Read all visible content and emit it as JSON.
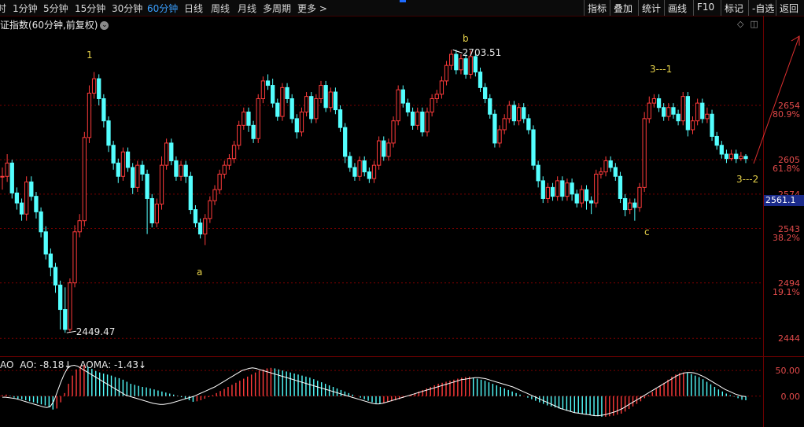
{
  "toolbar": {
    "periods": [
      {
        "label": "时",
        "active": false
      },
      {
        "label": "1分钟",
        "active": false
      },
      {
        "label": "5分钟",
        "active": false
      },
      {
        "label": "15分钟",
        "active": false
      },
      {
        "label": "30分钟",
        "active": false
      },
      {
        "label": "60分钟",
        "active": true
      },
      {
        "label": "日线",
        "active": false
      },
      {
        "label": "周线",
        "active": false
      },
      {
        "label": "月线",
        "active": false
      },
      {
        "label": "多周期",
        "active": false
      },
      {
        "label": "更多 >",
        "active": false
      }
    ],
    "tools": [
      "指标",
      "叠加",
      "统计",
      "画线",
      "F10",
      "标记",
      "-自选",
      "返回"
    ]
  },
  "chart_title": "证指数(60分钟,前复权)",
  "colors": {
    "up": "#ff3b3b",
    "down": "#54ffff",
    "axis": "#e24a4a",
    "grid": "#7a0000",
    "annotation": "#e8d34a",
    "ao_line": "#ffffff"
  },
  "price_axis": [
    {
      "value": "2654",
      "pct": "80.9%"
    },
    {
      "value": "2605",
      "pct": "61.8%"
    },
    {
      "value": "2574",
      "pct": ""
    },
    {
      "value": "2543",
      "pct": "38.2%"
    },
    {
      "value": "2494",
      "pct": "19.1%"
    },
    {
      "value": "2444",
      "pct": ""
    }
  ],
  "current_price": "2561.1",
  "ao_axis": [
    "50.00",
    "0.00"
  ],
  "ao_header": {
    "name": "AO",
    "ao": "AO: -8.18",
    "aoma": "AOMA: -1.43"
  },
  "annotations": {
    "high_marker": "2703.51",
    "low_marker": "2449.47",
    "wave_labels": [
      "1",
      "a",
      "b",
      "c",
      "3---1",
      "3---2"
    ]
  },
  "chart_data": {
    "type": "candlestick",
    "ylim": [
      2430,
      2722
    ],
    "high_value": 2703.51,
    "low_value": 2449.47,
    "candles": [
      [
        2590,
        2590,
        2598,
        2578
      ],
      [
        2590,
        2602,
        2610,
        2585
      ],
      [
        2602,
        2575,
        2605,
        2570
      ],
      [
        2575,
        2566,
        2580,
        2560
      ],
      [
        2566,
        2556,
        2570,
        2550
      ],
      [
        2556,
        2585,
        2590,
        2550
      ],
      [
        2585,
        2572,
        2590,
        2568
      ],
      [
        2572,
        2558,
        2576,
        2552
      ],
      [
        2558,
        2540,
        2562,
        2535
      ],
      [
        2540,
        2520,
        2545,
        2515
      ],
      [
        2520,
        2508,
        2525,
        2500
      ],
      [
        2508,
        2492,
        2512,
        2485
      ],
      [
        2492,
        2470,
        2496,
        2452
      ],
      [
        2470,
        2452,
        2490,
        2449
      ],
      [
        2452,
        2494,
        2498,
        2450
      ],
      [
        2494,
        2540,
        2546,
        2490
      ],
      [
        2540,
        2550,
        2556,
        2535
      ],
      [
        2550,
        2625,
        2630,
        2545
      ],
      [
        2625,
        2665,
        2672,
        2620
      ],
      [
        2665,
        2678,
        2684,
        2660
      ],
      [
        2678,
        2660,
        2682,
        2654
      ],
      [
        2660,
        2640,
        2664,
        2634
      ],
      [
        2640,
        2618,
        2644,
        2612
      ],
      [
        2618,
        2602,
        2622,
        2596
      ],
      [
        2602,
        2590,
        2606,
        2584
      ],
      [
        2590,
        2612,
        2616,
        2586
      ],
      [
        2612,
        2598,
        2616,
        2594
      ],
      [
        2598,
        2580,
        2602,
        2574
      ],
      [
        2580,
        2600,
        2604,
        2576
      ],
      [
        2600,
        2592,
        2604,
        2586
      ],
      [
        2592,
        2570,
        2596,
        2538
      ],
      [
        2570,
        2548,
        2574,
        2544
      ],
      [
        2548,
        2565,
        2570,
        2544
      ],
      [
        2565,
        2600,
        2608,
        2560
      ],
      [
        2600,
        2620,
        2624,
        2596
      ],
      [
        2620,
        2604,
        2624,
        2600
      ],
      [
        2604,
        2590,
        2608,
        2586
      ],
      [
        2590,
        2600,
        2604,
        2586
      ],
      [
        2600,
        2590,
        2604,
        2584
      ],
      [
        2590,
        2560,
        2594,
        2556
      ],
      [
        2560,
        2548,
        2564,
        2544
      ],
      [
        2548,
        2538,
        2552,
        2534
      ],
      [
        2538,
        2552,
        2556,
        2528
      ],
      [
        2552,
        2568,
        2572,
        2548
      ],
      [
        2568,
        2578,
        2582,
        2564
      ],
      [
        2578,
        2592,
        2596,
        2574
      ],
      [
        2592,
        2600,
        2604,
        2588
      ],
      [
        2600,
        2606,
        2610,
        2596
      ],
      [
        2606,
        2618,
        2622,
        2602
      ],
      [
        2618,
        2636,
        2640,
        2614
      ],
      [
        2636,
        2648,
        2652,
        2632
      ],
      [
        2648,
        2636,
        2652,
        2630
      ],
      [
        2636,
        2624,
        2640,
        2620
      ],
      [
        2624,
        2660,
        2664,
        2620
      ],
      [
        2660,
        2676,
        2680,
        2656
      ],
      [
        2676,
        2672,
        2682,
        2668
      ],
      [
        2672,
        2656,
        2678,
        2652
      ],
      [
        2656,
        2644,
        2660,
        2640
      ],
      [
        2644,
        2670,
        2674,
        2640
      ],
      [
        2670,
        2660,
        2674,
        2656
      ],
      [
        2660,
        2642,
        2664,
        2638
      ],
      [
        2642,
        2630,
        2646,
        2624
      ],
      [
        2630,
        2648,
        2652,
        2626
      ],
      [
        2648,
        2662,
        2666,
        2644
      ],
      [
        2662,
        2642,
        2666,
        2638
      ],
      [
        2642,
        2660,
        2664,
        2638
      ],
      [
        2660,
        2672,
        2676,
        2656
      ],
      [
        2672,
        2652,
        2676,
        2648
      ],
      [
        2652,
        2666,
        2670,
        2648
      ],
      [
        2666,
        2650,
        2670,
        2646
      ],
      [
        2650,
        2634,
        2654,
        2630
      ],
      [
        2634,
        2608,
        2638,
        2602
      ],
      [
        2608,
        2598,
        2612,
        2594
      ],
      [
        2598,
        2590,
        2602,
        2586
      ],
      [
        2590,
        2604,
        2608,
        2586
      ],
      [
        2604,
        2594,
        2608,
        2590
      ],
      [
        2594,
        2588,
        2598,
        2584
      ],
      [
        2588,
        2600,
        2604,
        2584
      ],
      [
        2600,
        2622,
        2626,
        2596
      ],
      [
        2622,
        2608,
        2626,
        2604
      ],
      [
        2608,
        2620,
        2624,
        2604
      ],
      [
        2620,
        2640,
        2644,
        2616
      ],
      [
        2640,
        2668,
        2672,
        2636
      ],
      [
        2668,
        2656,
        2672,
        2652
      ],
      [
        2656,
        2648,
        2660,
        2644
      ],
      [
        2648,
        2636,
        2652,
        2632
      ],
      [
        2636,
        2648,
        2652,
        2632
      ],
      [
        2648,
        2630,
        2652,
        2626
      ],
      [
        2630,
        2648,
        2652,
        2626
      ],
      [
        2648,
        2660,
        2664,
        2644
      ],
      [
        2660,
        2664,
        2668,
        2656
      ],
      [
        2664,
        2676,
        2680,
        2660
      ],
      [
        2676,
        2690,
        2694,
        2672
      ],
      [
        2690,
        2700,
        2704,
        2686
      ],
      [
        2700,
        2686,
        2704,
        2682
      ],
      [
        2686,
        2696,
        2700,
        2682
      ],
      [
        2696,
        2682,
        2700,
        2678
      ],
      [
        2682,
        2698,
        2703.51,
        2678
      ],
      [
        2698,
        2684,
        2700,
        2680
      ],
      [
        2684,
        2670,
        2688,
        2666
      ],
      [
        2670,
        2660,
        2674,
        2656
      ],
      [
        2660,
        2646,
        2664,
        2642
      ],
      [
        2646,
        2620,
        2650,
        2616
      ],
      [
        2620,
        2632,
        2636,
        2616
      ],
      [
        2632,
        2642,
        2646,
        2628
      ],
      [
        2642,
        2654,
        2658,
        2638
      ],
      [
        2654,
        2640,
        2658,
        2636
      ],
      [
        2640,
        2652,
        2656,
        2636
      ],
      [
        2652,
        2642,
        2656,
        2638
      ],
      [
        2642,
        2632,
        2646,
        2628
      ],
      [
        2632,
        2600,
        2636,
        2596
      ],
      [
        2600,
        2586,
        2604,
        2580
      ],
      [
        2586,
        2570,
        2590,
        2566
      ],
      [
        2570,
        2580,
        2584,
        2566
      ],
      [
        2580,
        2572,
        2584,
        2568
      ],
      [
        2572,
        2586,
        2590,
        2568
      ],
      [
        2586,
        2572,
        2590,
        2568
      ],
      [
        2572,
        2584,
        2588,
        2568
      ],
      [
        2584,
        2574,
        2588,
        2568
      ],
      [
        2574,
        2566,
        2578,
        2562
      ],
      [
        2566,
        2578,
        2582,
        2562
      ],
      [
        2578,
        2568,
        2582,
        2560
      ],
      [
        2568,
        2566,
        2572,
        2556
      ],
      [
        2566,
        2592,
        2596,
        2562
      ],
      [
        2592,
        2594,
        2598,
        2588
      ],
      [
        2594,
        2604,
        2608,
        2590
      ],
      [
        2604,
        2598,
        2608,
        2594
      ],
      [
        2598,
        2590,
        2602,
        2586
      ],
      [
        2590,
        2570,
        2594,
        2566
      ],
      [
        2570,
        2560,
        2574,
        2554
      ],
      [
        2560,
        2566,
        2570,
        2556
      ],
      [
        2566,
        2562,
        2570,
        2550
      ],
      [
        2562,
        2580,
        2584,
        2558
      ],
      [
        2580,
        2642,
        2648,
        2576
      ],
      [
        2642,
        2656,
        2662,
        2638
      ],
      [
        2656,
        2660,
        2664,
        2652
      ],
      [
        2660,
        2652,
        2664,
        2648
      ],
      [
        2652,
        2644,
        2656,
        2640
      ],
      [
        2644,
        2652,
        2656,
        2640
      ],
      [
        2652,
        2646,
        2656,
        2642
      ],
      [
        2646,
        2640,
        2650,
        2636
      ],
      [
        2640,
        2662,
        2666,
        2636
      ],
      [
        2662,
        2632,
        2666,
        2626
      ],
      [
        2632,
        2640,
        2644,
        2628
      ],
      [
        2640,
        2656,
        2660,
        2636
      ],
      [
        2656,
        2642,
        2660,
        2638
      ],
      [
        2642,
        2646,
        2652,
        2638
      ],
      [
        2646,
        2626,
        2650,
        2622
      ],
      [
        2626,
        2618,
        2630,
        2614
      ],
      [
        2618,
        2610,
        2622,
        2606
      ],
      [
        2610,
        2606,
        2614,
        2602
      ],
      [
        2606,
        2610,
        2614,
        2604
      ],
      [
        2610,
        2606,
        2614,
        2602
      ],
      [
        2606,
        2608,
        2612,
        2604
      ],
      [
        2608,
        2606,
        2610,
        2602
      ]
    ],
    "ao_values": [
      2,
      3,
      1,
      -3,
      -5,
      -6,
      -8,
      -10,
      -12,
      -14,
      -16,
      -18,
      -22,
      -26,
      -24,
      -12,
      6,
      24,
      40,
      52,
      58,
      60,
      57,
      53,
      49,
      46,
      44,
      42,
      40,
      37,
      35,
      32,
      28,
      24,
      22,
      20,
      18,
      17,
      15,
      13,
      11,
      9,
      7,
      5,
      3,
      1,
      -2,
      -5,
      -8,
      -11,
      -10,
      -8,
      -5,
      -2,
      2,
      6,
      10,
      14,
      18,
      22,
      26,
      30,
      34,
      38,
      42,
      46,
      50,
      52,
      54,
      55,
      54,
      52,
      50,
      48,
      46,
      44,
      42,
      40,
      38,
      36,
      33,
      30,
      27,
      24,
      21,
      18,
      15,
      12,
      9,
      6,
      3,
      0,
      -3,
      -6,
      -9,
      -12,
      -14,
      -15,
      -14,
      -12,
      -10,
      -8,
      -6,
      -3,
      0,
      3,
      6,
      9,
      12,
      15,
      18,
      21,
      24,
      26,
      28,
      30,
      32,
      34,
      36,
      37,
      38,
      36,
      34,
      32,
      30,
      27,
      24,
      21,
      18,
      15,
      12,
      9,
      6,
      3,
      0,
      -3,
      -6,
      -9,
      -12,
      -15,
      -18,
      -20,
      -22,
      -24,
      -26,
      -28,
      -30,
      -32,
      -34,
      -35,
      -36,
      -37,
      -38,
      -39,
      -40,
      -40,
      -39,
      -38,
      -36,
      -34,
      -30,
      -25,
      -20,
      -15,
      -10,
      -4,
      2,
      8,
      14,
      20,
      26,
      32,
      38,
      42,
      45,
      46,
      45,
      43,
      40,
      37,
      33,
      28,
      23,
      18,
      13,
      9,
      5,
      2,
      -1,
      -4,
      -7,
      -8
    ],
    "aoma_values": [
      -2,
      -2,
      -3,
      -4,
      -5,
      -7,
      -9,
      -11,
      -13,
      -15,
      -17,
      -19,
      -21,
      -22,
      -20,
      -10,
      8,
      26,
      42,
      54,
      59,
      60,
      58,
      54,
      50,
      46,
      42,
      38,
      34,
      30,
      26,
      22,
      18,
      14,
      10,
      6,
      2,
      0,
      -2,
      -4,
      -6,
      -8,
      -10,
      -12,
      -14,
      -15,
      -16,
      -16,
      -15,
      -14,
      -12,
      -10,
      -8,
      -6,
      -4,
      -2,
      0,
      3,
      6,
      9,
      12,
      15,
      18,
      22,
      26,
      30,
      34,
      38,
      42,
      46,
      50,
      52,
      54,
      55,
      54,
      52,
      50,
      48,
      46,
      44,
      42,
      40,
      38,
      36,
      34,
      32,
      30,
      28,
      26,
      24,
      22,
      20,
      18,
      16,
      14,
      12,
      10,
      8,
      6,
      4,
      2,
      0,
      -2,
      -4,
      -6,
      -8,
      -10,
      -12,
      -14,
      -15,
      -15,
      -14,
      -12,
      -10,
      -8,
      -6,
      -4,
      -2,
      0,
      2,
      4,
      6,
      8,
      10,
      12,
      14,
      16,
      18,
      20,
      22,
      24,
      26,
      28,
      30,
      32,
      33,
      34,
      35,
      36,
      36,
      35,
      34,
      32,
      30,
      28,
      26,
      24,
      22,
      20,
      18,
      15,
      12,
      9,
      6,
      3,
      0,
      -3,
      -6,
      -9,
      -12,
      -15,
      -18,
      -21,
      -24,
      -26,
      -28,
      -30,
      -32,
      -33,
      -34,
      -35,
      -36,
      -37,
      -38,
      -38,
      -37,
      -36,
      -34,
      -32,
      -30,
      -27,
      -24,
      -20,
      -16,
      -12,
      -8,
      -4,
      0,
      4,
      8,
      12,
      16,
      20,
      24,
      28,
      32,
      36,
      40,
      43,
      45,
      46,
      46,
      45,
      43,
      40,
      37,
      33,
      29,
      25,
      21,
      17,
      13,
      10,
      7,
      4,
      2,
      0,
      -1
    ]
  }
}
